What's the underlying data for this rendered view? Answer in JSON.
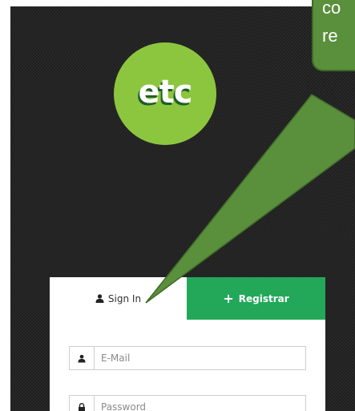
{
  "brand": {
    "logo_text": "etc",
    "accent": "#8cc63f",
    "register_color": "#23a85a"
  },
  "tabs": {
    "signin": {
      "label": "Sign In",
      "icon": "user-icon"
    },
    "register": {
      "label": "Registrar",
      "icon": "plus-icon"
    }
  },
  "form": {
    "email": {
      "placeholder": "E-Mail",
      "icon": "user-icon"
    },
    "password": {
      "placeholder": "Password",
      "icon": "lock-icon"
    }
  },
  "callout": {
    "line1": "co",
    "line2": "re",
    "color": "#5a8f3c"
  }
}
